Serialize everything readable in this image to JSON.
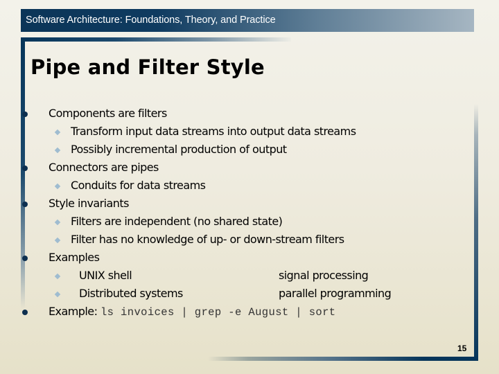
{
  "header": {
    "title": "Software Architecture: Foundations, Theory, and Practice"
  },
  "slide": {
    "title": "Pipe and Filter Style",
    "page_number": "15",
    "bullets": [
      {
        "text": "Components are filters",
        "sub": [
          "Transform input data streams into output data streams",
          "Possibly incremental production of output"
        ]
      },
      {
        "text": "Connectors are pipes",
        "sub": [
          "Conduits for data streams"
        ]
      },
      {
        "text": "Style invariants",
        "sub": [
          "Filters are independent (no shared state)",
          "Filter has no knowledge of up- or down-stream filters"
        ]
      },
      {
        "text": "Examples",
        "sub": [
          {
            "left": "UNIX shell",
            "right": "signal processing"
          },
          {
            "left": "Distributed systems",
            "right": "parallel programming"
          }
        ]
      },
      {
        "text": "Example:",
        "code": "ls invoices | grep -e August | sort"
      }
    ]
  },
  "colors": {
    "accent_navy": "#06355a",
    "bullet_dot": "#0d2f4f",
    "sub_bullet_diamond": "#9fbcd0"
  }
}
